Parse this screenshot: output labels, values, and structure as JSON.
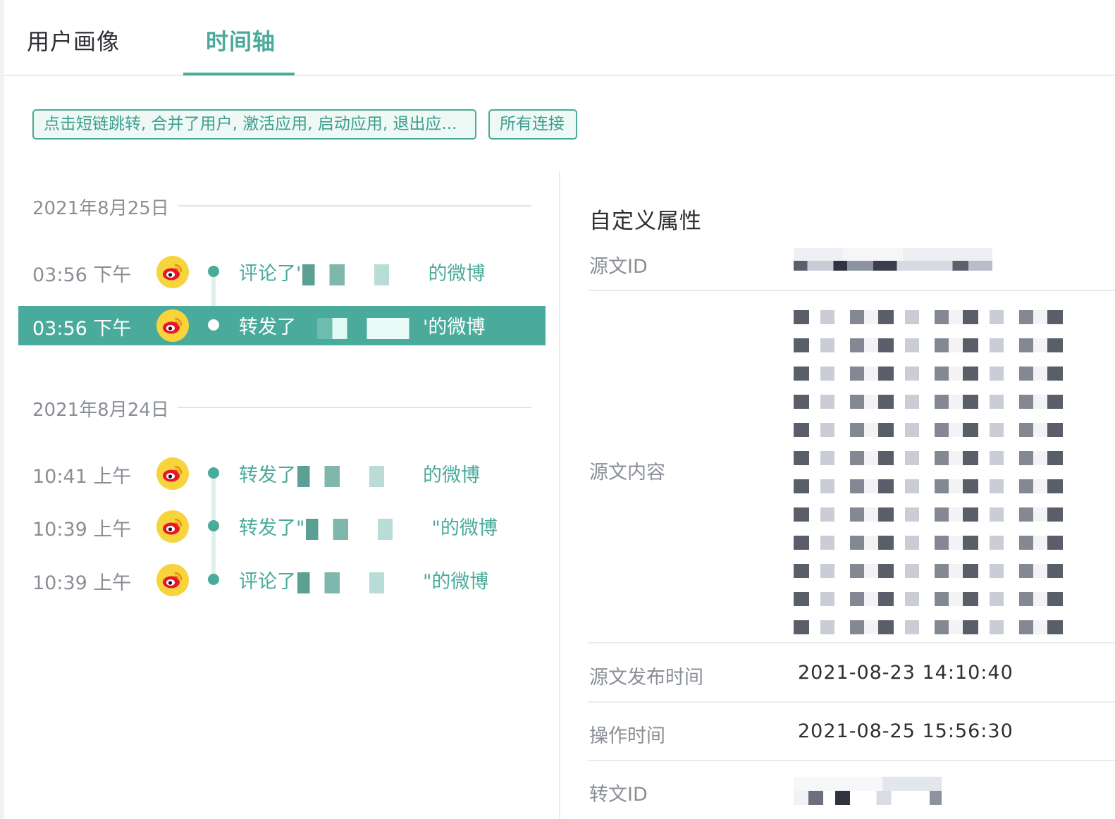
{
  "tabs": [
    {
      "label": "用户画像",
      "active": false
    },
    {
      "label": "时间轴",
      "active": true
    }
  ],
  "filters": {
    "events_label": "点击短链跳转, 合并了用户, 激活应用, 启动应用, 退出应...",
    "connections_label": "所有连接"
  },
  "timeline": {
    "groups": [
      {
        "date": "2021年8月25日",
        "items": [
          {
            "time": "03:56 下午",
            "prefix": "评论了'",
            "suffix": "的微博",
            "selected": false
          },
          {
            "time": "03:56 下午",
            "prefix": "转发了",
            "suffix": "'的微博",
            "selected": true
          }
        ]
      },
      {
        "date": "2021年8月24日",
        "items": [
          {
            "time": "10:41 上午",
            "prefix": "转发了",
            "suffix": "的微博",
            "selected": false
          },
          {
            "time": "10:39 上午",
            "prefix": "转发了\"",
            "suffix": "\"的微博",
            "selected": false
          },
          {
            "time": "10:39 上午",
            "prefix": "评论了",
            "suffix": "\"的微博",
            "selected": false
          }
        ]
      }
    ]
  },
  "properties": {
    "title": "自定义属性",
    "source_id_label": "源文ID",
    "source_content_label": "源文内容",
    "publish_time_label": "源文发布时间",
    "publish_time_value": "2021-08-23 14:10:40",
    "operation_time_label": "操作时间",
    "operation_time_value": "2021-08-25 15:56:30",
    "repost_id_label": "转文ID"
  },
  "colors": {
    "accent": "#4aaa9b",
    "weibo_badge": "#f7d33c",
    "weibo_logo": "#e6162d"
  }
}
